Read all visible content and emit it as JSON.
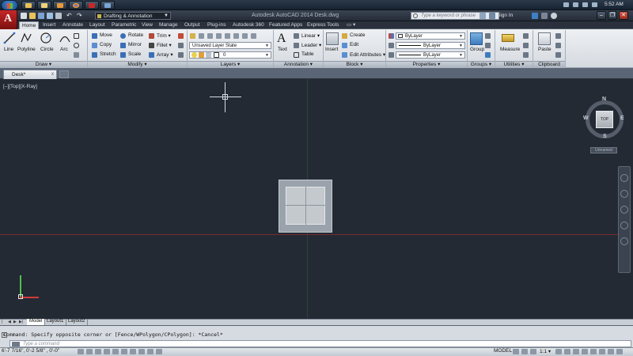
{
  "taskbar": {
    "time": "5:52 AM",
    "icons": [
      "windows-start-icon",
      "explorer-icon",
      "media-icon",
      "chrome-icon",
      "autocad-icon",
      "app-icon"
    ]
  },
  "titlebar": {
    "workspace": "Drafting & Annotation",
    "title": "Autodesk AutoCAD 2014    Desk.dwg",
    "search_placeholder": "Type a keyword or phrase",
    "sign_in": "Sign In",
    "minimize": "–",
    "restore": "❐",
    "close": "✕"
  },
  "ribbon_tabs": [
    "Home",
    "Insert",
    "Annotate",
    "Layout",
    "Parametric",
    "View",
    "Manage",
    "Output",
    "Plug-ins",
    "Autodesk 360",
    "Featured Apps",
    "Express Tools"
  ],
  "ribbon": {
    "draw": {
      "label": "Draw ▾",
      "tools": [
        "Line",
        "Polyline",
        "Circle",
        "Arc"
      ]
    },
    "modify": {
      "label": "Modify ▾",
      "rows": [
        [
          "Move",
          "Rotate",
          "Trim ▾"
        ],
        [
          "Copy",
          "Mirror",
          "Fillet ▾"
        ],
        [
          "Stretch",
          "Scale",
          "Array ▾"
        ]
      ]
    },
    "layers": {
      "label": "Layers ▾",
      "state": "Unsaved Layer State",
      "current": "0"
    },
    "annotation": {
      "label": "Annotation ▾",
      "text": "Text",
      "tools": [
        "Linear ▾",
        "Leader ▾",
        "Table"
      ]
    },
    "block": {
      "label": "Block ▾",
      "insert": "Insert",
      "tools": [
        "Create",
        "Edit",
        "Edit Attributes ▾"
      ]
    },
    "properties": {
      "label": "Properties ▾",
      "color": "ByLayer",
      "linetype": "ByLayer",
      "lineweight": "ByLayer"
    },
    "groups": {
      "label": "Groups ▾",
      "group": "Group"
    },
    "utilities": {
      "label": "Utilities ▾",
      "measure": "Measure"
    },
    "clipboard": {
      "label": "Clipboard",
      "paste": "Paste"
    }
  },
  "doc_tab": {
    "name": "Desk*",
    "close": "x"
  },
  "viewport": {
    "label": "[–][Top][X-Ray]",
    "viewcube": {
      "face": "TOP",
      "n": "N",
      "s": "S",
      "e": "E",
      "w": "W",
      "ucs": "Unnamed"
    }
  },
  "layout_tabs": [
    "Model",
    "Layout1",
    "Layout2"
  ],
  "layout_nav": [
    "|◀",
    "◀",
    "▶",
    "▶|"
  ],
  "command": {
    "history": "Command: Specify opposite corner or [Fence/WPolygon/CPolygon]: *Cancel*",
    "placeholder": "Type a command"
  },
  "status": {
    "coords": "6'-7 7/16\",  0'-2 5/8\"  , 0'-0\"",
    "model": "MODEL",
    "scale": "1:1 ▾"
  },
  "colors": {
    "canvas": "#232a34",
    "app_button": "#c62828",
    "x_axis": "#d03a3a",
    "y_axis": "#4fbf4f"
  }
}
